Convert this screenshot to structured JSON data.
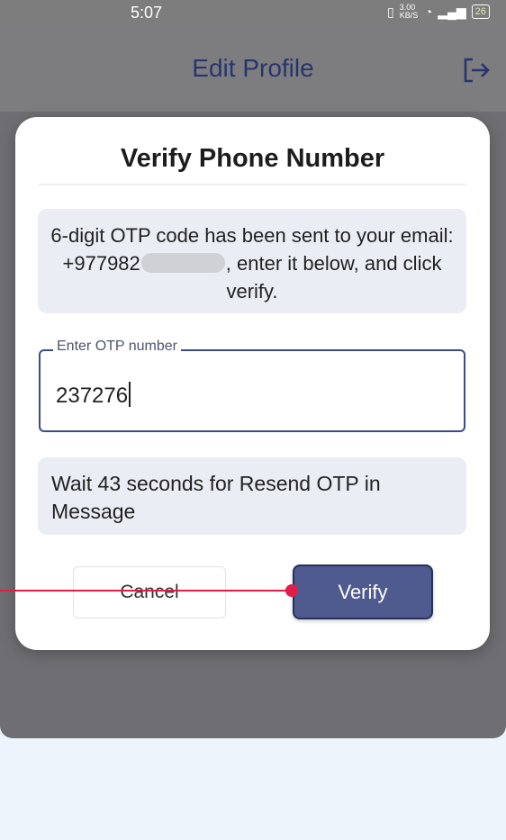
{
  "status_bar": {
    "time": "5:07",
    "net_speed": "3.00 KB/S",
    "battery": "26"
  },
  "app_bar": {
    "title": "Edit Profile",
    "logout_icon": "logout-icon"
  },
  "dialog": {
    "title": "Verify Phone Number",
    "info_prefix": "6-digit OTP code has been sent to your email: +977982",
    "info_suffix": ", enter it below, and click verify.",
    "otp_label": "Enter OTP number",
    "otp_value": "237276",
    "wait_text": "Wait 43 seconds for Resend OTP in Message",
    "cancel_label": "Cancel",
    "verify_label": "Verify"
  },
  "colors": {
    "accent": "#4f5a8e",
    "title_color": "#27356e",
    "annotation": "#e11d48"
  }
}
